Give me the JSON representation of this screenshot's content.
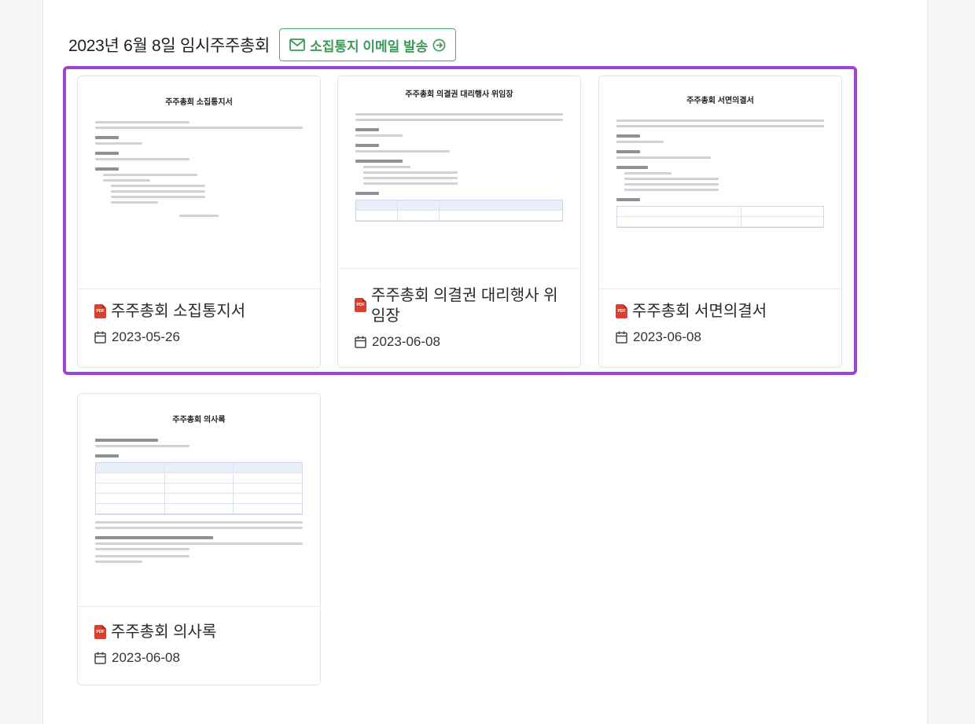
{
  "header": {
    "title": "2023년 6월 8일 임시주주총회",
    "email_button_label": "소집통지 이메일 발송"
  },
  "colors": {
    "accent_green": "#3a9a58",
    "selection_purple": "#9a45d6",
    "pdf_red": "#d8412f"
  },
  "documents": [
    {
      "title": "주주총회 소집통지서",
      "date": "2023-05-26",
      "thumb_title": "주주총회 소집통지서",
      "icon": "pdf-icon"
    },
    {
      "title": "주주총회 의결권 대리행사 위임장",
      "date": "2023-06-08",
      "thumb_title": "주주총회 의결권 대리행사 위임장",
      "icon": "pdf-icon"
    },
    {
      "title": "주주총회 서면의결서",
      "date": "2023-06-08",
      "thumb_title": "주주총회 서면의결서",
      "icon": "pdf-icon"
    },
    {
      "title": "주주총회 의사록",
      "date": "2023-06-08",
      "thumb_title": "주주총회 의사록",
      "icon": "pdf-icon"
    }
  ]
}
